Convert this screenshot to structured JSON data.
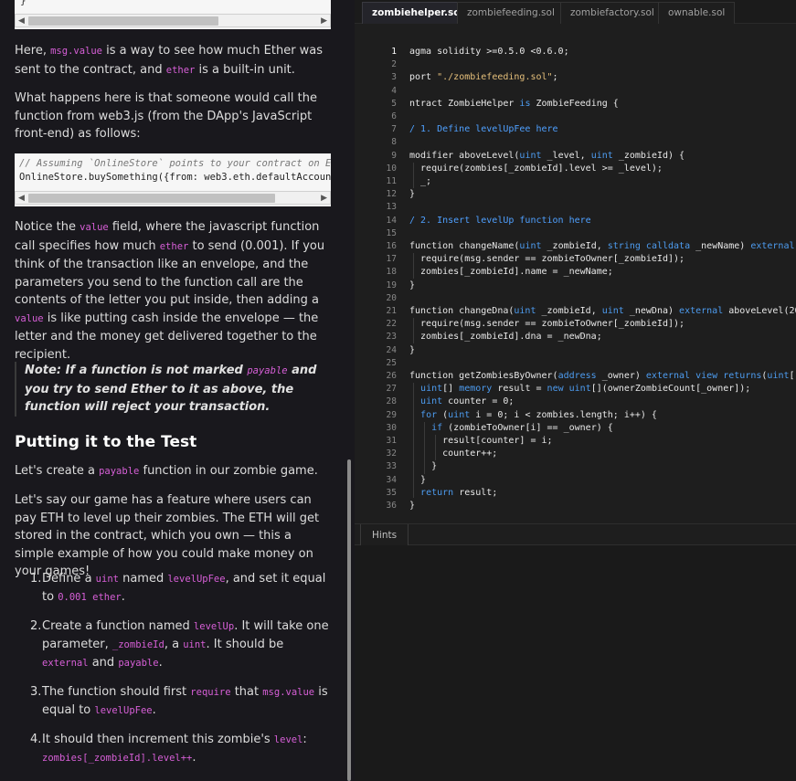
{
  "lesson": {
    "top_brace": "}",
    "p1": {
      "a": "Here, ",
      "code1": "msg.value",
      "b": " is a way to see how much Ether was sent to the contract, and ",
      "code2": "ether",
      "c": " is a built-in unit."
    },
    "p2": "What happens here is that someone would call the function from web3.js (from the DApp's JavaScript front-end) as follows:",
    "snippet_line1": "// Assuming `OnlineStore` points to your contract on Eth",
    "snippet_line2": "OnlineStore.buySomething({from: web3.eth.defaultAccount,",
    "p3": {
      "a": "Notice the ",
      "code1": "value",
      "b": " field, where the javascript function call specifies how much ",
      "code2": "ether",
      "c": " to send (0.001). If you think of the transaction like an envelope, and the parameters you send to the function call are the contents of the letter you put inside, then adding a ",
      "code3": "value",
      "d": " is like putting cash inside the envelope — the letter and the money get delivered together to the recipient."
    },
    "note": {
      "a": "Note: If a function is not marked ",
      "code1": "payable",
      "b": " and you try to send Ether to it as above, the function will reject your transaction."
    },
    "heading": "Putting it to the Test",
    "p4": {
      "a": "Let's create a ",
      "code1": "payable",
      "b": " function in our zombie game."
    },
    "p5": "Let's say our game has a feature where users can pay ETH to level up their zombies. The ETH will get stored in the contract, which you own — this a simple example of how you could make money on your games!",
    "steps": [
      {
        "num": "1.",
        "a": "Define a ",
        "c1": "uint",
        "b": " named ",
        "c2": "levelUpFee",
        "c": ", and set it equal to ",
        "c3": "0.001 ether",
        "d": "."
      },
      {
        "num": "2.",
        "a": "Create a function named ",
        "c1": "levelUp",
        "b": ". It will take one parameter, ",
        "c2": "_zombieId",
        "c": ", a ",
        "c3": "uint",
        "d": ". It should be ",
        "c4": "external",
        "e": " and ",
        "c5": "payable",
        "f": "."
      },
      {
        "num": "3.",
        "a": "The function should first ",
        "c1": "require",
        "b": " that ",
        "c2": "msg.value",
        "c": " is equal to ",
        "c3": "levelUpFee",
        "d": "."
      },
      {
        "num": "4.",
        "a": "It should then increment this zombie's ",
        "c1": "level",
        "b": ": ",
        "c2": "zombies[_zombieId].level++",
        "c": "."
      }
    ]
  },
  "editor": {
    "tabs": [
      "zombiehelper.sol",
      "zombiefeeding.sol",
      "zombiefactory.sol",
      "ownable.sol"
    ],
    "active_tab": 0,
    "hints_tab": "Hints",
    "line_numbers": [
      "1",
      "2",
      "3",
      "4",
      "5",
      "6",
      "7",
      "8",
      "9",
      "10",
      "11",
      "12",
      "13",
      "14",
      "15",
      "16",
      "17",
      "18",
      "19",
      "20",
      "21",
      "22",
      "23",
      "24",
      "25",
      "26",
      "27",
      "28",
      "29",
      "30",
      "31",
      "32",
      "33",
      "34",
      "35",
      "36"
    ],
    "lines": [
      "agma solidity >=0.5.0 <0.6.0;",
      "",
      "port \"./zombiefeeding.sol\";",
      "",
      "ntract ZombieHelper is ZombieFeeding {",
      "",
      "/ 1. Define levelUpFee here",
      "",
      "modifier aboveLevel(uint _level, uint _zombieId) {",
      "  require(zombies[_zombieId].level >= _level);",
      "  _;",
      "}",
      "",
      "/ 2. Insert levelUp function here",
      "",
      "function changeName(uint _zombieId, string calldata _newName) external abo",
      "  require(msg.sender == zombieToOwner[_zombieId]);",
      "  zombies[_zombieId].name = _newName;",
      "}",
      "",
      "function changeDna(uint _zombieId, uint _newDna) external aboveLevel(20, _",
      "  require(msg.sender == zombieToOwner[_zombieId]);",
      "  zombies[_zombieId].dna = _newDna;",
      "}",
      "",
      "function getZombiesByOwner(address _owner) external view returns(uint[] me",
      "  uint[] memory result = new uint[](ownerZombieCount[_owner]);",
      "  uint counter = 0;",
      "  for (uint i = 0; i < zombies.length; i++) {",
      "    if (zombieToOwner[i] == _owner) {",
      "      result[counter] = i;",
      "      counter++;",
      "    }",
      "  }",
      "  return result;",
      "}"
    ]
  }
}
